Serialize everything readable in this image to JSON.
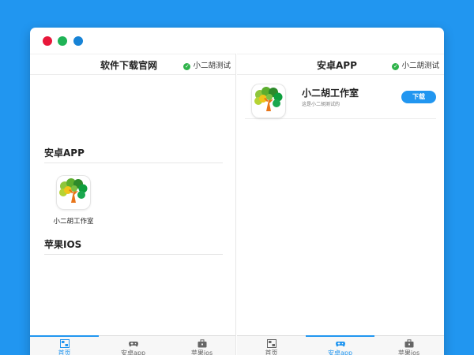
{
  "left_pane": {
    "title": "软件下载官网",
    "status": "小二胡测试",
    "sections": [
      {
        "title": "安卓APP"
      },
      {
        "title": "苹果IOS"
      }
    ],
    "app_tile": {
      "name": "小二胡工作室"
    }
  },
  "right_pane": {
    "title": "安卓APP",
    "status": "小二胡测试",
    "app": {
      "name": "小二胡工作室",
      "description": "这是小二胡测试的",
      "download_label": "下载"
    }
  },
  "tabs": [
    {
      "label": "首页",
      "icon": "home-icon"
    },
    {
      "label": "安卓app",
      "icon": "gamepad-icon"
    },
    {
      "label": "苹果ios",
      "icon": "briefcase-icon"
    }
  ],
  "left_active_tab": 0,
  "right_active_tab": 1,
  "colors": {
    "background": "#2196f0",
    "accent": "#2196f0",
    "close": "#e8173a",
    "minimize": "#1fb356",
    "maximize": "#1783d6",
    "status_check": "#2fb34a"
  }
}
